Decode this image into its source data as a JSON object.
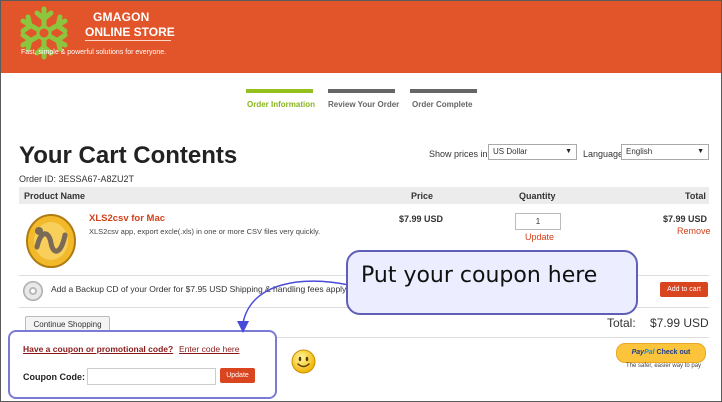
{
  "brand": {
    "name_line1": "GMAGON",
    "name_line2": "ONLINE STORE",
    "tagline": "Fast, simple & powerful solutions for everyone."
  },
  "steps": [
    {
      "label": "Order Information",
      "active": true
    },
    {
      "label": "Review Your Order",
      "active": false
    },
    {
      "label": "Order Complete",
      "active": false
    }
  ],
  "page": {
    "title": "Your Cart Contents",
    "order_id": "Order ID: 3ESSA67-A8ZU2T"
  },
  "prefs": {
    "prices_label": "Show prices in:",
    "currency": "US Dollar",
    "language_label": "Language",
    "language": "English"
  },
  "table": {
    "headers": {
      "product": "Product Name",
      "price": "Price",
      "quantity": "Quantity",
      "total": "Total"
    },
    "item": {
      "name": "XLS2csv for Mac",
      "description": "XLS2csv app, export excle(.xls) in one or more CSV files very quickly.",
      "price": "$7.99 USD",
      "quantity": "1",
      "update_label": "Update",
      "total": "$7.99 USD",
      "remove_label": "Remove"
    }
  },
  "backup": {
    "text": "Add a Backup CD of your Order for $7.95 USD Shipping & handling fees apply",
    "button": "Add to cart"
  },
  "footer": {
    "continue_label": "Continue Shopping",
    "total_label": "Total:",
    "total_value": "$7.99 USD"
  },
  "coupon": {
    "question": "Have a coupon or promotional code?",
    "enter_link": "Enter code here",
    "code_label": "Coupon Code:",
    "update_label": "Update",
    "value": ""
  },
  "paypal": {
    "part1": "Pay",
    "part2": "Pal",
    "suffix": "Check out",
    "tagline": "The safer, easier way to pay"
  },
  "callout": {
    "text": "Put your coupon here"
  },
  "colors": {
    "header": "#e2542a",
    "accent_green": "#95c11f",
    "button": "#d9451f",
    "callout_border": "#5f5fb8"
  }
}
